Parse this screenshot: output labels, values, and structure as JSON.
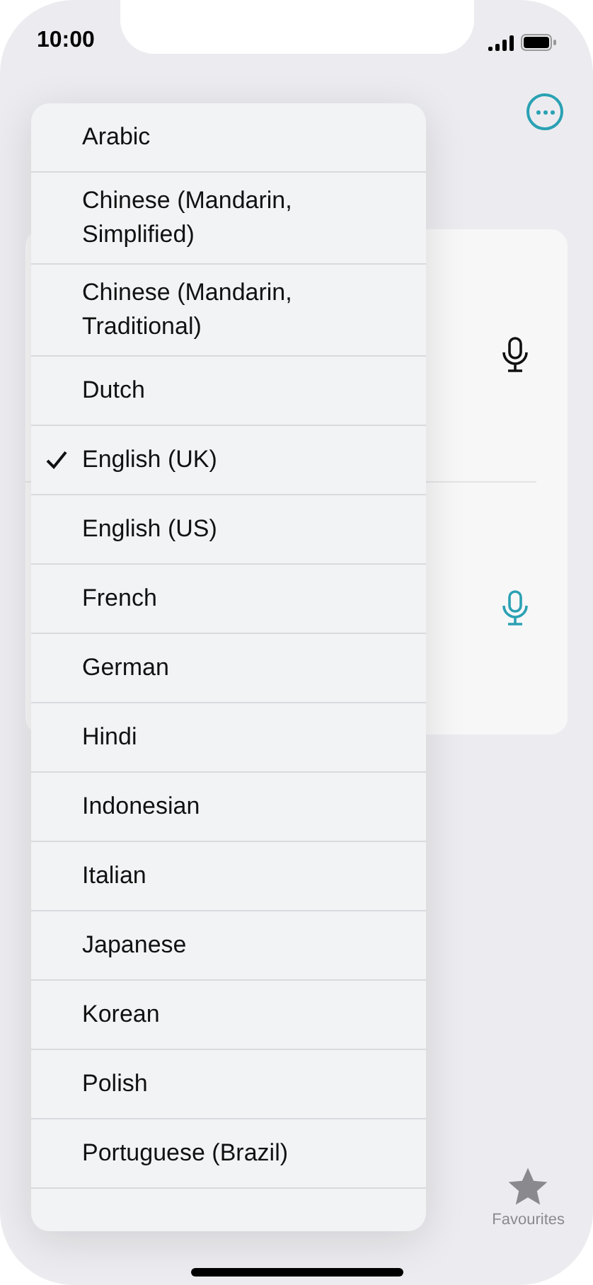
{
  "status_bar": {
    "time": "10:00"
  },
  "inputs": [
    {
      "active": false
    },
    {
      "active": true
    }
  ],
  "language_menu": [
    {
      "label": "Arabic",
      "selected": false
    },
    {
      "label": "Chinese (Mandarin, Simplified)",
      "selected": false
    },
    {
      "label": "Chinese (Mandarin, Traditional)",
      "selected": false
    },
    {
      "label": "Dutch",
      "selected": false
    },
    {
      "label": "English (UK)",
      "selected": true
    },
    {
      "label": "English (US)",
      "selected": false
    },
    {
      "label": "French",
      "selected": false
    },
    {
      "label": "German",
      "selected": false
    },
    {
      "label": "Hindi",
      "selected": false
    },
    {
      "label": "Indonesian",
      "selected": false
    },
    {
      "label": "Italian",
      "selected": false
    },
    {
      "label": "Japanese",
      "selected": false
    },
    {
      "label": "Korean",
      "selected": false
    },
    {
      "label": "Polish",
      "selected": false
    },
    {
      "label": "Portuguese (Brazil)",
      "selected": false
    }
  ],
  "tab_bar": {
    "items": [
      {
        "label": "Favourites"
      }
    ]
  }
}
